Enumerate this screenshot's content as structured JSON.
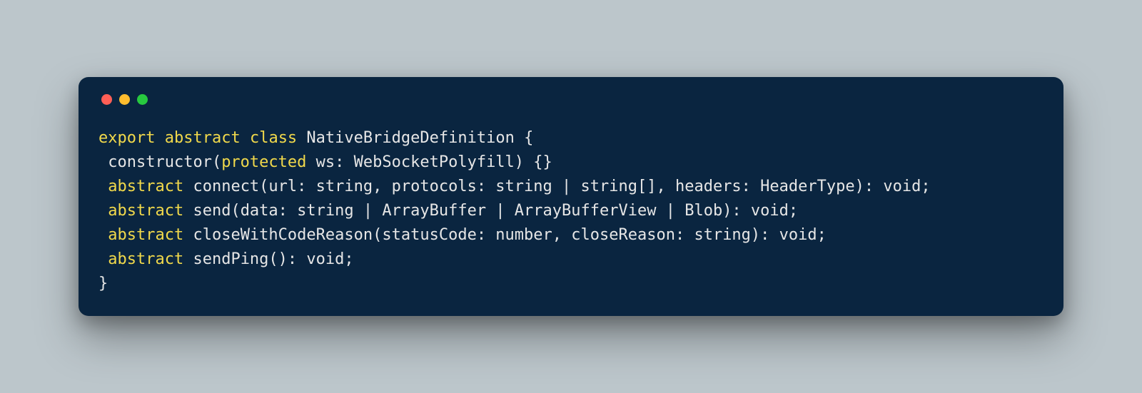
{
  "code": {
    "line1": {
      "kw1": "export",
      "kw2": "abstract",
      "kw3": "class",
      "rest": " NativeBridgeDefinition {"
    },
    "line2": {
      "pre": " constructor(",
      "kw": "protected",
      "post": " ws: WebSocketPolyfill) {}"
    },
    "line3": {
      "kw": " abstract",
      "rest": " connect(url: string, protocols: string | string[], headers: HeaderType): void;"
    },
    "line4": {
      "kw": " abstract",
      "rest": " send(data: string | ArrayBuffer | ArrayBufferView | Blob): void;"
    },
    "line5": {
      "kw": " abstract",
      "rest": " closeWithCodeReason(statusCode: number, closeReason: string): void;"
    },
    "line6": {
      "kw": " abstract",
      "rest": " sendPing(): void;"
    },
    "line7": {
      "rest": "}"
    }
  }
}
